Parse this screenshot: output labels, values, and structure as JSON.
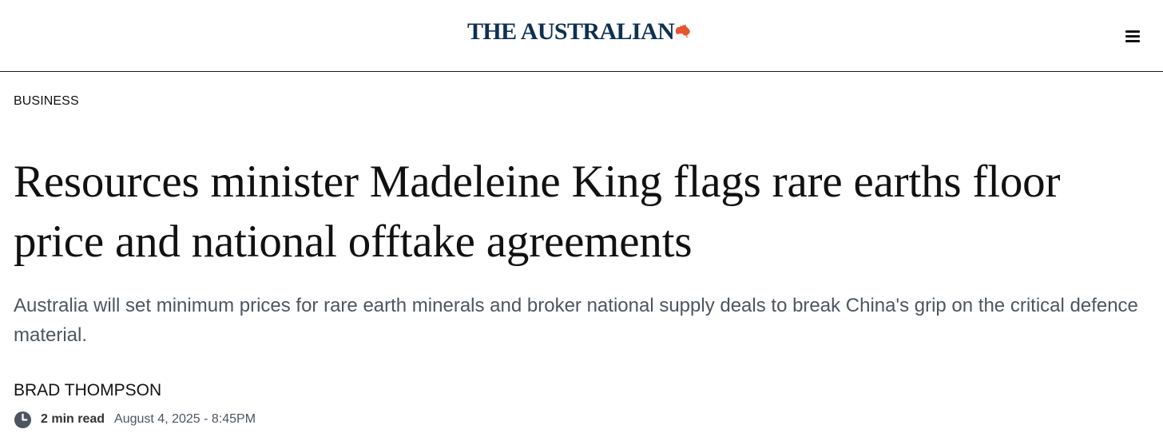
{
  "masthead": {
    "logo_text": "THE AUSTRALIAN",
    "logo_icon": "australia-map-icon",
    "logo_color": "#0e3152",
    "logo_icon_color": "#e4572e",
    "menu_icon": "hamburger-menu-icon"
  },
  "article": {
    "section": "BUSINESS",
    "headline": "Resources minister Madeleine King flags rare earths floor price and national offtake agreements",
    "standfirst": "Australia will set minimum prices for rare earth minerals and broker national supply deals to break China's grip on the critical defence material.",
    "author": "BRAD THOMPSON",
    "read_time": "2 min read",
    "published": "August 4, 2025 - 8:45PM",
    "clock_icon": "clock-icon"
  }
}
